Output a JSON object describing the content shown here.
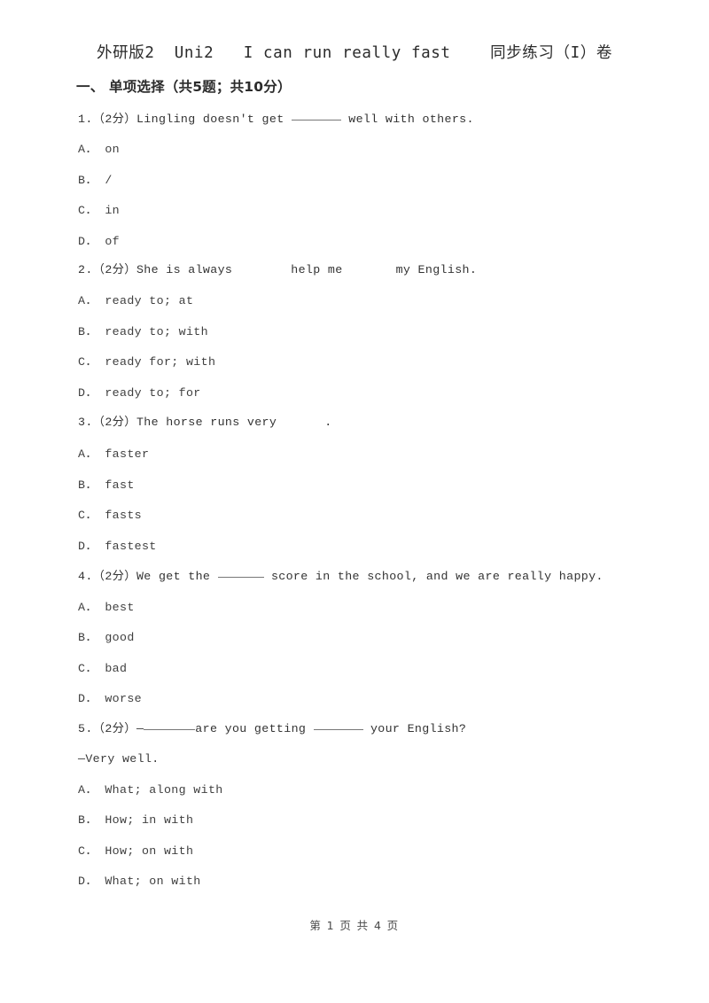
{
  "document": {
    "title": "外研版2  Uni2   I can run really fast    同步练习（I）卷",
    "section_header": "一、 单项选择（共5题；共10分）",
    "footer": "第 1 页 共 4 页"
  },
  "questions": [
    {
      "number": "1.",
      "points": "（2分）",
      "stem_before": "Lingling doesn't get",
      "stem_after": "well with others.",
      "blank_style": "underline",
      "options": [
        {
          "label": "A．",
          "text": "on"
        },
        {
          "label": "B．",
          "text": "/"
        },
        {
          "label": "C．",
          "text": "in"
        },
        {
          "label": "D．",
          "text": "of"
        }
      ]
    },
    {
      "number": "2.",
      "points": "（2分）",
      "stem_before": "She is always",
      "stem_middle": "help me",
      "stem_after": "my English.",
      "blank_style": "gap",
      "options": [
        {
          "label": "A．",
          "text": "ready to; at"
        },
        {
          "label": "B．",
          "text": "ready to; with"
        },
        {
          "label": "C．",
          "text": "ready for; with"
        },
        {
          "label": "D．",
          "text": "ready to; for"
        }
      ]
    },
    {
      "number": "3.",
      "points": "（2分）",
      "stem_before": "The horse runs very",
      "stem_after": ".",
      "blank_style": "gap",
      "options": [
        {
          "label": "A．",
          "text": "faster"
        },
        {
          "label": "B．",
          "text": "fast"
        },
        {
          "label": "C．",
          "text": "fasts"
        },
        {
          "label": "D．",
          "text": "fastest"
        }
      ]
    },
    {
      "number": "4.",
      "points": "（2分）",
      "stem_before": "We get the",
      "stem_after": "score in the school, and we are really happy.",
      "blank_style": "underline",
      "options": [
        {
          "label": "A．",
          "text": "best"
        },
        {
          "label": "B．",
          "text": "good"
        },
        {
          "label": "C．",
          "text": "bad"
        },
        {
          "label": "D．",
          "text": "worse"
        }
      ]
    },
    {
      "number": "5.",
      "points": "（2分）",
      "stem_dash": "—",
      "stem_middle": "are you getting",
      "stem_after": "your English?",
      "answer_line": "—Very well.",
      "blank_style": "underline",
      "options": [
        {
          "label": "A．",
          "text": "What; along with"
        },
        {
          "label": "B．",
          "text": "How; in with"
        },
        {
          "label": "C．",
          "text": "How; on with"
        },
        {
          "label": "D．",
          "text": "What; on with"
        }
      ]
    }
  ]
}
